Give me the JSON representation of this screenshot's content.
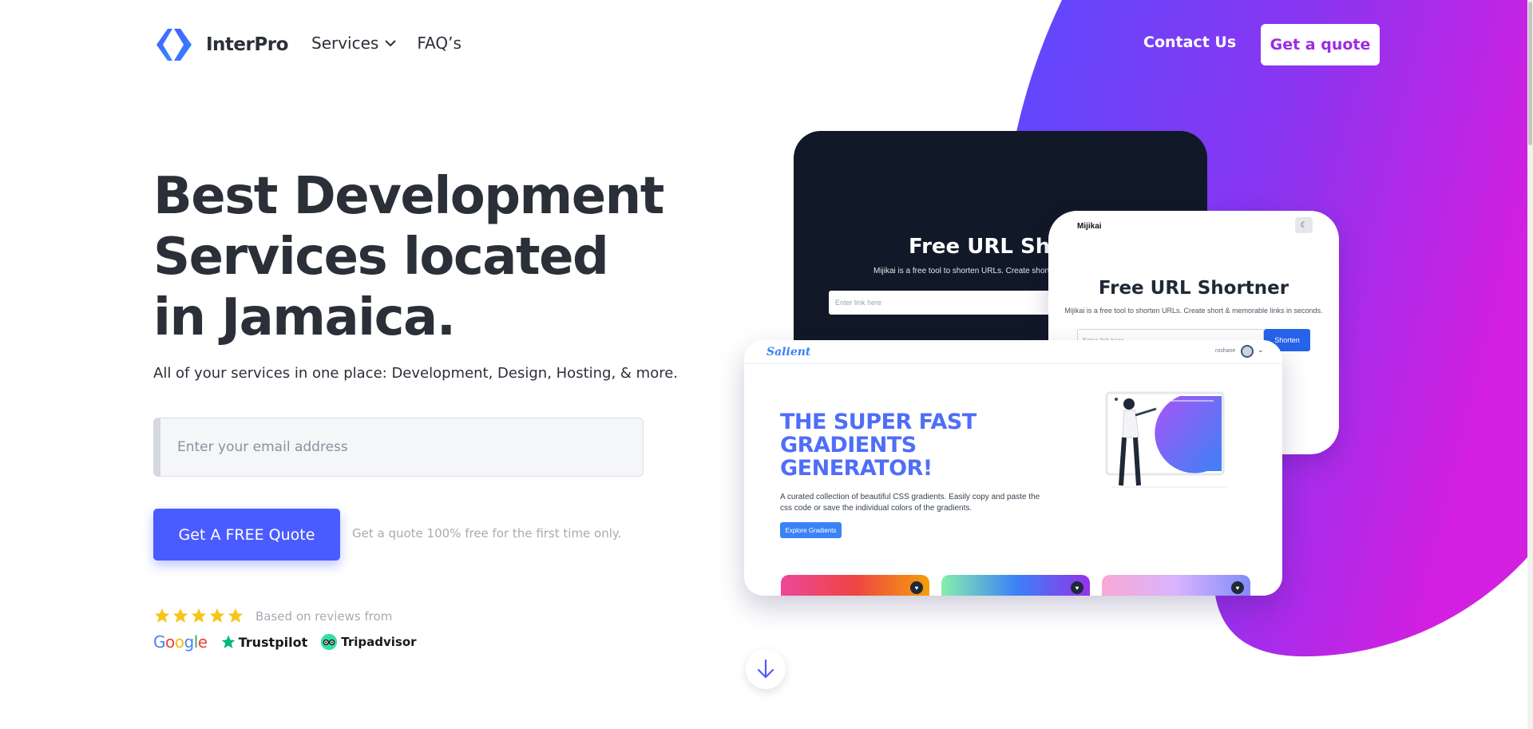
{
  "header": {
    "logo_text": "InterPro",
    "nav": [
      {
        "label": "Services",
        "has_dropdown": true
      },
      {
        "label": "FAQ’s",
        "has_dropdown": false
      }
    ],
    "contact_label": "Contact Us",
    "quote_label": "Get a quote"
  },
  "hero": {
    "headline_lines": [
      "Best Development",
      "Services located",
      "in Jamaica."
    ],
    "subline": "All of your services in one place: Development, Design, Hosting, & more.",
    "email_placeholder": "Enter your email address",
    "cta_label": "Get A FREE Quote",
    "cta_note": "Get a quote 100% free for the first time only."
  },
  "reviews": {
    "rating_stars": 5,
    "text": "Based on reviews from",
    "platforms": [
      "Google",
      "Trustpilot",
      "Tripadvisor"
    ]
  },
  "mockups": {
    "dark_card": {
      "title": "Free URL Shor",
      "description": "Mijikai is a free tool to shorten URLs. Create short & me",
      "input_placeholder": "Enter link here"
    },
    "white_card": {
      "brand": "Mijikai",
      "toggle_icon": "moon-icon",
      "title": "Free URL Shortner",
      "description": "Mijikai is a free tool to shorten URLs. Create short & memorable links in seconds.",
      "input_placeholder": "Enter link here",
      "button_label": "Shorten"
    },
    "main_card": {
      "brand": "Salient",
      "user": "roshane",
      "heading_lines": [
        "THE SUPER FAST",
        "GRADIENTS",
        "GENERATOR!"
      ],
      "paragraph": "A curated collection of beautiful CSS gradients. Easily copy and paste the css code or save the individual colors of the gradients.",
      "button_label": "Explore Gradients"
    }
  },
  "colors": {
    "primary": "#4a5cff",
    "accent_purple": "#9b2be0",
    "text_dark": "#2b2f38",
    "muted": "#a8abb3",
    "gradient_start": "#5b4bff",
    "gradient_end": "#d21fe0",
    "star": "#f5c518"
  },
  "icons": {
    "logo": "chevrons-logo-icon",
    "services_dropdown": "chevron-down-icon",
    "scroll_down": "arrow-down-icon"
  }
}
